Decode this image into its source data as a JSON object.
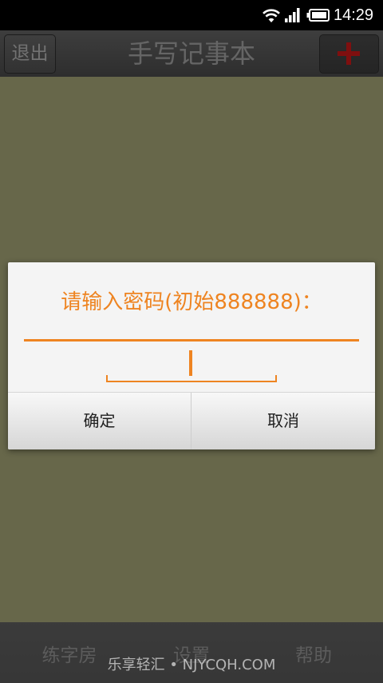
{
  "status_bar": {
    "time": "14:29",
    "icons": [
      "wifi-icon",
      "signal-icon",
      "battery-icon"
    ]
  },
  "toolbar": {
    "exit_label": "退出",
    "title": "手写记事本",
    "add_icon": "plus-icon"
  },
  "dialog": {
    "title": "请输入密码(初始888888)：",
    "password_value": "",
    "confirm_label": "确定",
    "cancel_label": "取消"
  },
  "bottom_nav": {
    "items": [
      {
        "label": "练字房"
      },
      {
        "label": "设置"
      },
      {
        "label": "帮助"
      }
    ]
  },
  "watermark": "乐享轻汇 • NJYCQH.COM",
  "colors": {
    "accent": "#ee8421",
    "add_icon": "#ff1e1e",
    "content_background": "#cfcf94",
    "backdrop": "rgba(0,0,0,0.5)"
  }
}
